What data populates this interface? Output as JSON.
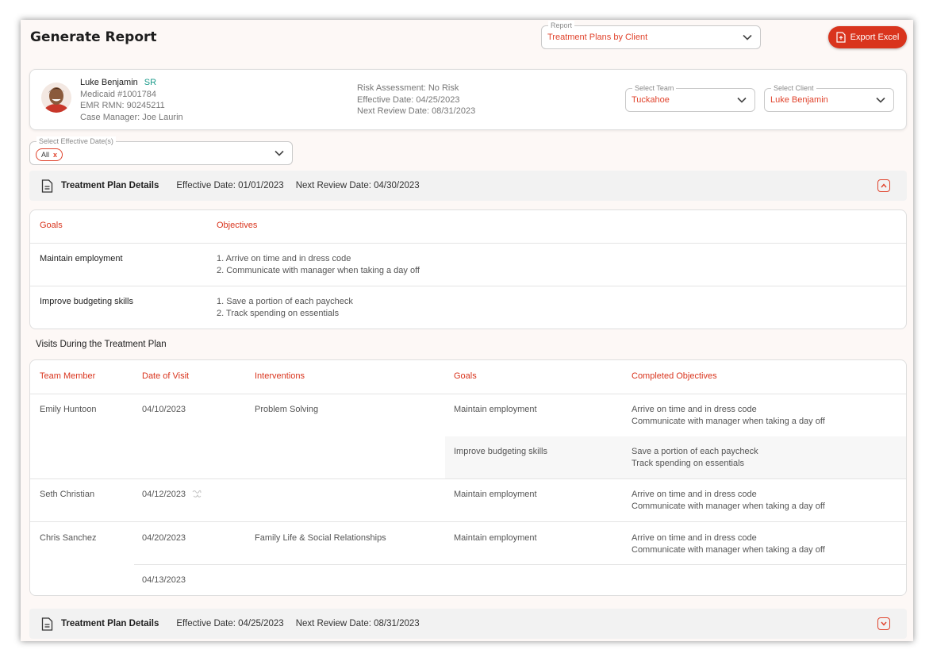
{
  "header": {
    "title": "Generate Report",
    "report_label": "Report",
    "report_value": "Treatment Plans by Client",
    "export_label": "Export Excel"
  },
  "client": {
    "name": "Luke Benjamin",
    "tag": "SR",
    "medicaid": "Medicaid #1001784",
    "emr": "EMR RMN: 90245211",
    "case_manager": "Case Manager: Joe Laurin",
    "risk": "Risk Assessment: No Risk",
    "effective": "Effective Date: 04/25/2023",
    "next_review": "Next Review Date: 08/31/2023",
    "team_label": "Select Team",
    "team_value": "Tuckahoe",
    "client_label": "Select Client",
    "client_value": "Luke Benjamin"
  },
  "dates_filter": {
    "label": "Select Effective Date(s)",
    "chip": "All",
    "chip_remove": "x"
  },
  "plans": [
    {
      "title": "Treatment Plan Details",
      "effective": "Effective Date: 01/01/2023",
      "review": "Next Review Date: 04/30/2023"
    },
    {
      "title": "Treatment Plan Details",
      "effective": "Effective Date: 04/25/2023",
      "review": "Next Review Date: 08/31/2023"
    }
  ],
  "goals_table": {
    "headers": [
      "Goals",
      "Objectives"
    ],
    "rows": [
      {
        "goal": "Maintain employment",
        "obj1": "1. Arrive on time and in dress code",
        "obj2": "2. Communicate with manager when taking a day off"
      },
      {
        "goal": "Improve budgeting skills",
        "obj1": "1. Save a portion of each paycheck",
        "obj2": "2. Track spending on essentials"
      }
    ]
  },
  "visits": {
    "title": "Visits During the Treatment Plan",
    "headers": [
      "Team Member",
      "Date of Visit",
      "Interventions",
      "Goals",
      "Completed Objectives"
    ],
    "rows": [
      {
        "member": "Emily Huntoon",
        "date": "04/10/2023",
        "intervention": "Problem Solving",
        "goal": "Maintain employment",
        "obj1": "Arrive on time and in dress code",
        "obj2": "Communicate with manager when taking a day off"
      },
      {
        "goal": "Improve budgeting skills",
        "obj1": "Save a portion of each paycheck",
        "obj2": "Track spending on essentials"
      },
      {
        "member": "Seth Christian",
        "date": "04/12/2023",
        "goal": "Maintain employment",
        "obj1": "Arrive on time and in dress code",
        "obj2": "Communicate with manager when taking a day off"
      },
      {
        "member": "Chris Sanchez",
        "date": "04/20/2023",
        "intervention": "Family Life & Social Relationships",
        "goal": "Maintain employment",
        "obj1": "Arrive on time and in dress code",
        "obj2": "Communicate with manager when taking a day off"
      },
      {
        "date": "04/13/2023"
      }
    ]
  },
  "colors": {
    "accent": "#d9341d",
    "tag": "#1a9a8a",
    "background": "#fdf8f6"
  }
}
